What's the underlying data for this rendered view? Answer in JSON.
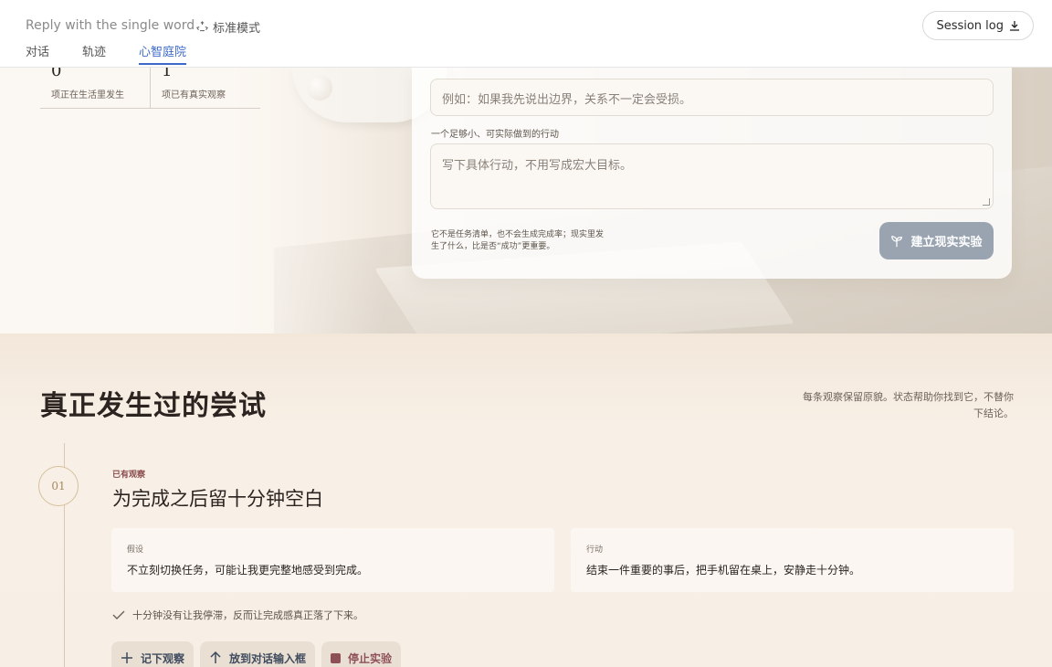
{
  "header": {
    "title": "Reply with the single word",
    "mode_label": "标准模式",
    "session_button": "Session log",
    "tabs": [
      {
        "label": "对话",
        "active": false
      },
      {
        "label": "轨迹",
        "active": false
      },
      {
        "label": "心智庭院",
        "active": true
      }
    ]
  },
  "stats": [
    {
      "value": "0",
      "label": "项正在生活里发生"
    },
    {
      "value": "1",
      "label": "项已有真实观察"
    }
  ],
  "form": {
    "hypothesis_placeholder": "例如：如果我先说出边界，关系不一定会受损。",
    "action_label": "一个足够小、可实际做到的行动",
    "action_placeholder": "写下具体行动，不用写成宏大目标。",
    "note": "它不是任务清单，也不会生成完成率；现实里发生了什么，比是否“成功”更重要。",
    "create_button": "建立现实实验"
  },
  "section": {
    "title": "真正发生过的尝试",
    "description": "每条观察保留原貌。状态帮助你找到它，不替你下结论。"
  },
  "entry": {
    "number": "01",
    "tag": "已有观察",
    "title": "为完成之后留十分钟空白",
    "hypothesis_key": "假设",
    "hypothesis_value": "不立刻切换任务，可能让我更完整地感受到完成。",
    "action_key": "行动",
    "action_value": "结束一件重要的事后，把手机留在桌上，安静走十分钟。",
    "observation": "十分钟没有让我停滞，反而让完成感真正落了下来。",
    "buttons": {
      "record": "记下观察",
      "send": "放到对话输入框",
      "stop": "停止实验"
    }
  },
  "colors": {
    "accent": "#3d6ac9",
    "tag": "#8a4b4b",
    "button_disabled": "#9aa4b1",
    "stop": "#8e5057"
  }
}
